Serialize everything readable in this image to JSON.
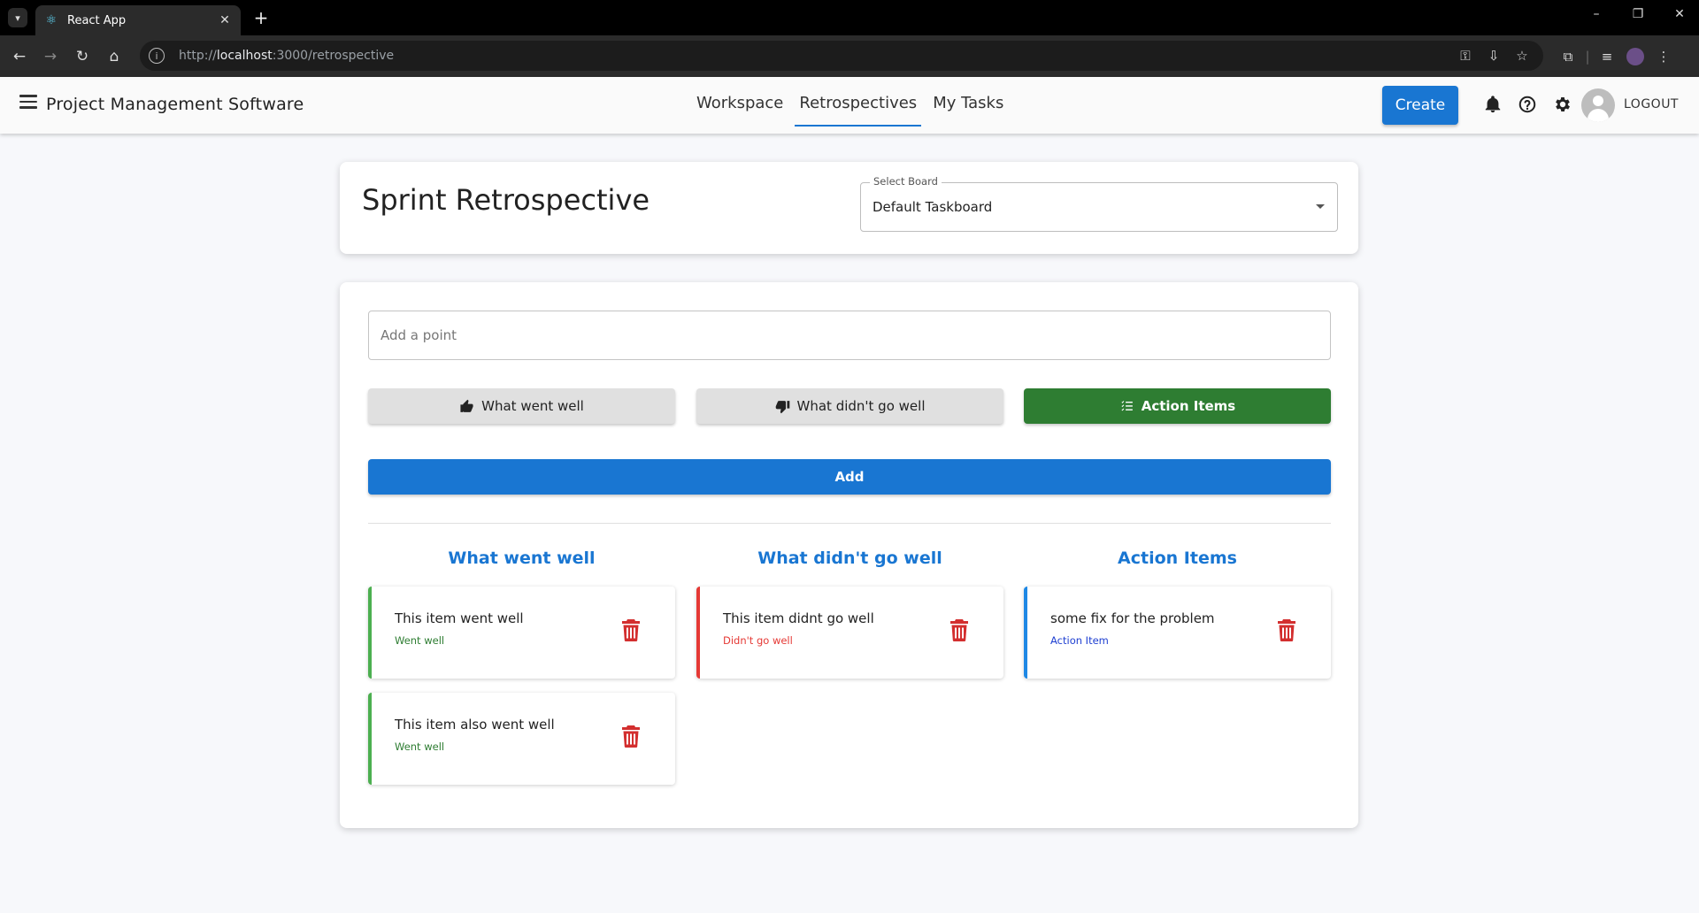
{
  "browser": {
    "tab_title": "React App",
    "url_prefix": "http://",
    "url_host": "localhost",
    "url_path": ":3000/retrospective"
  },
  "appbar": {
    "title": "Project Management Software",
    "nav": [
      "Workspace",
      "Retrospectives",
      "My Tasks"
    ],
    "active_nav": "Retrospectives",
    "create_label": "Create",
    "logout_label": "LOGOUT"
  },
  "header": {
    "title": "Sprint Retrospective",
    "select_label": "Select Board",
    "select_value": "Default Taskboard"
  },
  "form": {
    "input_placeholder": "Add a point",
    "input_value": "",
    "categories": [
      {
        "label": "What went well",
        "icon": "thumbs-up-icon",
        "selected": false
      },
      {
        "label": "What didn't go well",
        "icon": "thumbs-down-icon",
        "selected": false
      },
      {
        "label": "Action Items",
        "icon": "checklist-icon",
        "selected": true
      }
    ],
    "add_label": "Add"
  },
  "columns": [
    {
      "title": "What went well",
      "items": [
        {
          "text": "This item went well",
          "tag": "Went well"
        },
        {
          "text": "This item also went well",
          "tag": "Went well"
        }
      ]
    },
    {
      "title": "What didn't go well",
      "items": [
        {
          "text": "This item didnt go well",
          "tag": "Didn't go well"
        }
      ]
    },
    {
      "title": "Action Items",
      "items": [
        {
          "text": "some fix for the problem",
          "tag": "Action Item"
        }
      ]
    }
  ],
  "colors": {
    "primary": "#1976d2",
    "good": "#2e7d32",
    "bad": "#e53935",
    "action": "#1e88e5"
  }
}
